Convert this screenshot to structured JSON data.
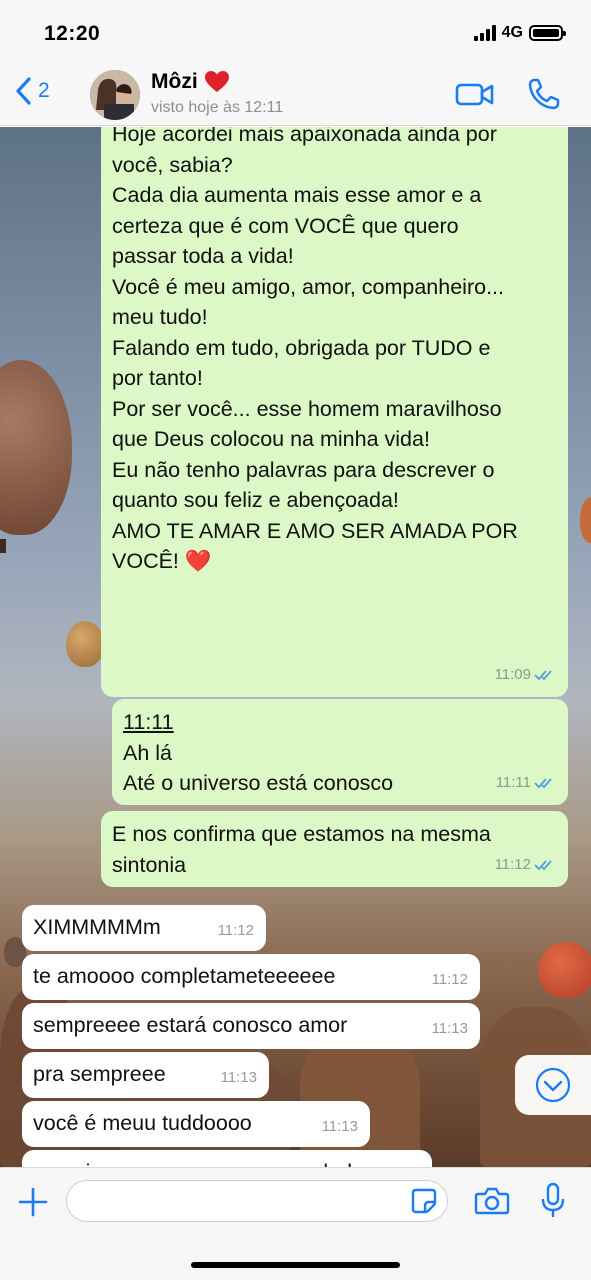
{
  "status_bar": {
    "time": "12:20",
    "network": "4G"
  },
  "header": {
    "back_count": "2",
    "contact_name": "Môzi",
    "contact_status": "visto hoje às 12:11"
  },
  "messages": [
    {
      "direction": "out",
      "lines": [
        "Hoje acordei mais apaixonada ainda por",
        "você, sabia?",
        "",
        "Cada dia aumenta mais esse amor e a",
        "certeza que é com VOCÊ que quero",
        "passar toda a vida!",
        "Você é meu amigo, amor, companheiro...",
        "meu tudo!",
        "Falando em tudo, obrigada por TUDO e",
        "por tanto!",
        "Por ser você... esse homem maravilhoso",
        "que Deus colocou na minha vida!",
        "",
        "Eu não tenho palavras para descrever o",
        "quanto sou feliz e abençoada!",
        "",
        "AMO TE AMAR E AMO SER AMADA POR",
        "VOCÊ! ❤️"
      ],
      "time": "11:09"
    },
    {
      "direction": "out",
      "lines": [
        "11:11",
        "Ah lá",
        "Até o universo está conosco"
      ],
      "time": "11:11"
    },
    {
      "direction": "out",
      "lines": [
        "E nos confirma que estamos na mesma",
        "sintonia"
      ],
      "time": "11:12"
    },
    {
      "direction": "in",
      "lines": [
        "XIMMMMMm"
      ],
      "time": "11:12"
    },
    {
      "direction": "in",
      "lines": [
        "te amoooo completameteeeeee"
      ],
      "time": "11:12"
    },
    {
      "direction": "in",
      "lines": [
        "sempreeee estará conosco amor"
      ],
      "time": "11:13"
    },
    {
      "direction": "in",
      "lines": [
        "pra sempreee"
      ],
      "time": "11:13"
    },
    {
      "direction": "in",
      "lines": [
        "você é meuu tuddoooo"
      ],
      "time": "11:13"
    },
    {
      "direction": "in",
      "lines": [
        "que viver pra sempree ao seu ladoo"
      ],
      "time": ""
    }
  ],
  "input": {
    "placeholder": ""
  },
  "colors": {
    "accent": "#1a7cf5",
    "outgoing_bubble": "#dcf8c6",
    "incoming_bubble": "#ffffff",
    "read_ticks": "#4fa3e0"
  },
  "icons": [
    "back-chevron-icon",
    "video-call-icon",
    "phone-icon",
    "heart-emoji-icon",
    "double-check-icon",
    "chevron-down-icon",
    "plus-icon",
    "sticker-icon",
    "camera-icon",
    "microphone-icon"
  ]
}
